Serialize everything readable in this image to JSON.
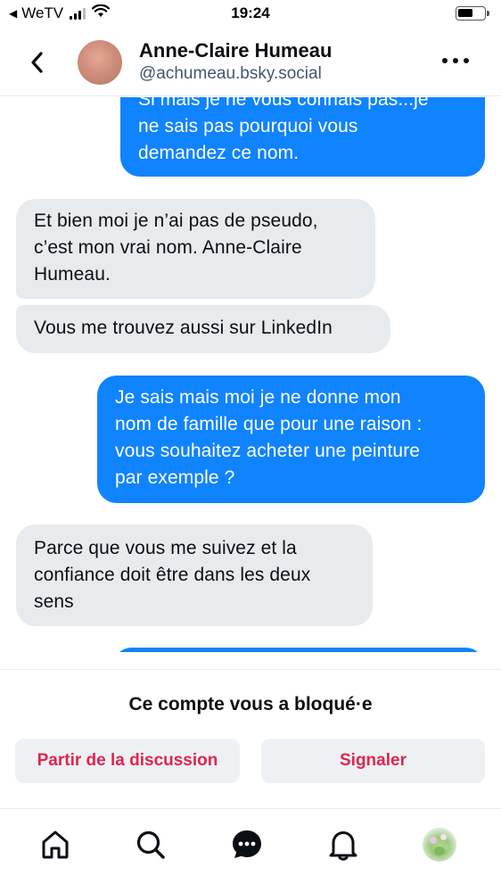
{
  "status_bar": {
    "back_app": "WeTV",
    "time": "19:24"
  },
  "header": {
    "name": "Anne-Claire Humeau",
    "handle": "@achumeau.bsky.social"
  },
  "messages": [
    {
      "from": "me",
      "text": "Si mais je ne vous connais pas...je\nne sais pas pourquoi vous\ndemandez ce nom."
    },
    {
      "from": "them",
      "text": "Et bien moi je n’ai pas de pseudo,\nc’est mon vrai nom. Anne-Claire\nHumeau."
    },
    {
      "from": "them",
      "text": "Vous me trouvez aussi sur LinkedIn"
    },
    {
      "from": "me",
      "text": "Je sais mais moi je ne donne mon\nnom de famille que pour une raison :\nvous souhaitez acheter une peinture\npar exemple ?"
    },
    {
      "from": "them",
      "text": "Parce que vous me suivez et la\nconfiance doit être dans les deux\nsens"
    }
  ],
  "blocked": {
    "title": "Ce compte vous a bloqué·e",
    "leave_label": "Partir de la discussion",
    "report_label": "Signaler"
  },
  "nav": {
    "items": [
      "home-icon",
      "search-icon",
      "chat-icon",
      "bell-icon",
      "profile-avatar"
    ],
    "active": "chat-icon"
  },
  "colors": {
    "outgoing_bubble": "#1083fe",
    "incoming_bubble": "#e8ebee",
    "danger_text": "#e0254e",
    "handle_text": "#42576c"
  }
}
